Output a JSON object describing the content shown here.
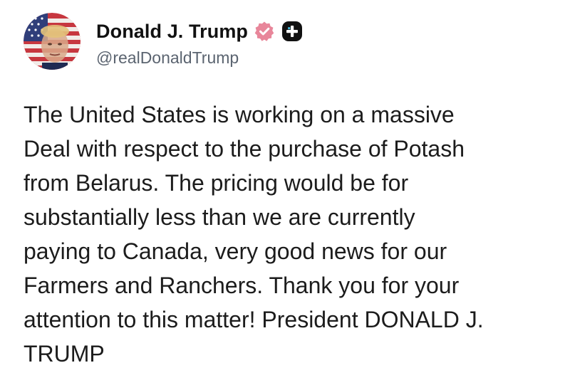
{
  "author": {
    "display_name": "Donald J. Trump",
    "handle": "@realDonaldTrump",
    "verified_icon": "verified-badge-icon",
    "subscribe_icon": "plus-badge-icon"
  },
  "post": {
    "lines": [
      "The United States is working on a massive",
      "Deal with respect to the purchase of Potash",
      "from Belarus. The pricing would be for",
      "substantially less than we are currently",
      "paying to Canada, very good news for our",
      "Farmers and Ranchers. Thank you for your",
      "attention to this matter! President DONALD J.",
      "TRUMP"
    ]
  },
  "colors": {
    "verified_badge": "#e8869a",
    "plus_badge": "#111111",
    "handle_text": "#5b6470",
    "body_text": "#1c1c1c"
  }
}
